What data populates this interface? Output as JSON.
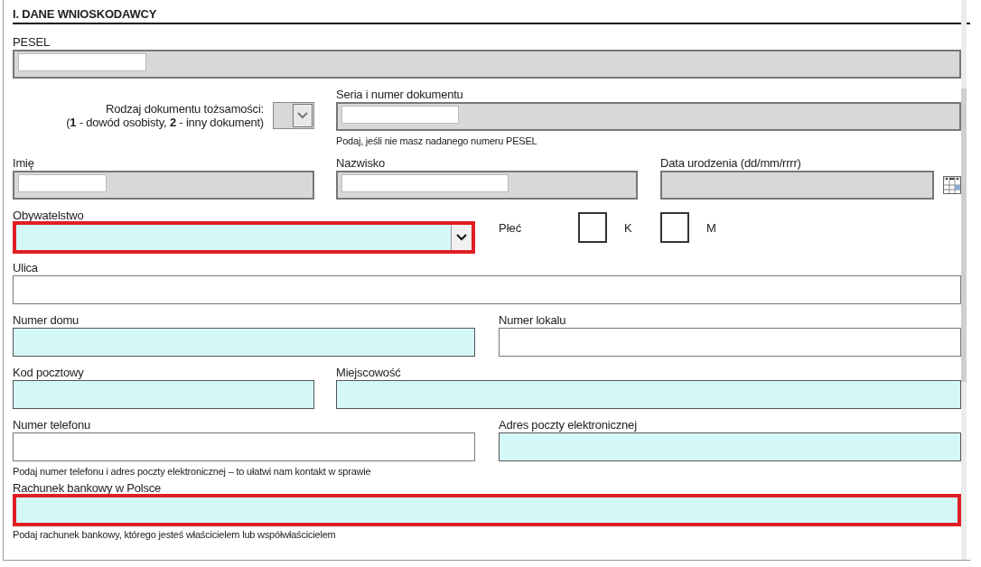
{
  "section_title": "I. DANE WNIOSKODAWCY",
  "rows": [
    {
      "fields": [
        {
          "kind": "text",
          "label": "PESEL",
          "disabled": true,
          "required": false,
          "error": false,
          "masked": true
        }
      ]
    },
    {
      "fields": [
        {
          "kind": "doctype",
          "label": "Rodzaj dokumentu tożsamości:",
          "note": "(**1** - dowód osobisty, **2** - inny dokument)",
          "disabled": true,
          "required": false,
          "error": false,
          "masked": false
        },
        {
          "kind": "text",
          "label": "Seria i numer dokumentu",
          "hint": "Podaj, jeśli nie masz nadanego numeru PESEL",
          "disabled": true,
          "required": false,
          "error": false,
          "masked": true
        }
      ]
    },
    {
      "fields": [
        {
          "kind": "text",
          "label": "Imię",
          "disabled": true,
          "required": false,
          "error": false,
          "masked": true
        },
        {
          "kind": "text",
          "label": "Nazwisko",
          "disabled": true,
          "required": false,
          "error": false,
          "masked": true
        },
        {
          "kind": "date",
          "label": "Data urodzenia (dd/mm/rrrr)",
          "disabled": true,
          "required": false,
          "error": false,
          "masked": false
        }
      ]
    },
    {
      "fields": [
        {
          "kind": "select",
          "label": "Obywatelstwo",
          "disabled": false,
          "required": true,
          "error": true,
          "masked": false
        },
        {
          "kind": "gender",
          "label": "Płeć",
          "options": [
            {
              "label": "K",
              "checked": false
            },
            {
              "label": "M",
              "checked": false
            }
          ]
        }
      ]
    },
    {
      "fields": [
        {
          "kind": "text",
          "label": "Ulica",
          "disabled": false,
          "required": false,
          "error": false,
          "masked": false
        }
      ]
    },
    {
      "fields": [
        {
          "kind": "text",
          "label": "Numer domu",
          "disabled": false,
          "required": true,
          "error": false,
          "masked": false
        },
        {
          "kind": "text",
          "label": "Numer lokalu",
          "disabled": false,
          "required": false,
          "error": false,
          "masked": false
        }
      ]
    },
    {
      "fields": [
        {
          "kind": "text",
          "label": "Kod pocztowy",
          "disabled": false,
          "required": true,
          "error": false,
          "masked": false
        },
        {
          "kind": "text",
          "label": "Miejscowość",
          "disabled": false,
          "required": true,
          "error": false,
          "masked": false
        }
      ]
    },
    {
      "fields": [
        {
          "kind": "text",
          "label": "Numer telefonu",
          "hint": "Podaj numer telefonu i adres poczty elektronicznej – to ułatwi nam kontakt w sprawie",
          "disabled": false,
          "required": false,
          "error": false,
          "masked": false
        },
        {
          "kind": "text",
          "label": "Adres poczty elektronicznej",
          "disabled": false,
          "required": true,
          "error": false,
          "masked": false
        }
      ]
    },
    {
      "fields": [
        {
          "kind": "text",
          "label": "Rachunek bankowy w Polsce",
          "hint": "Podaj rachunek bankowy, którego jesteś właścicielem lub współwłaścicielem",
          "disabled": false,
          "required": true,
          "error": true,
          "masked": false
        }
      ]
    }
  ]
}
